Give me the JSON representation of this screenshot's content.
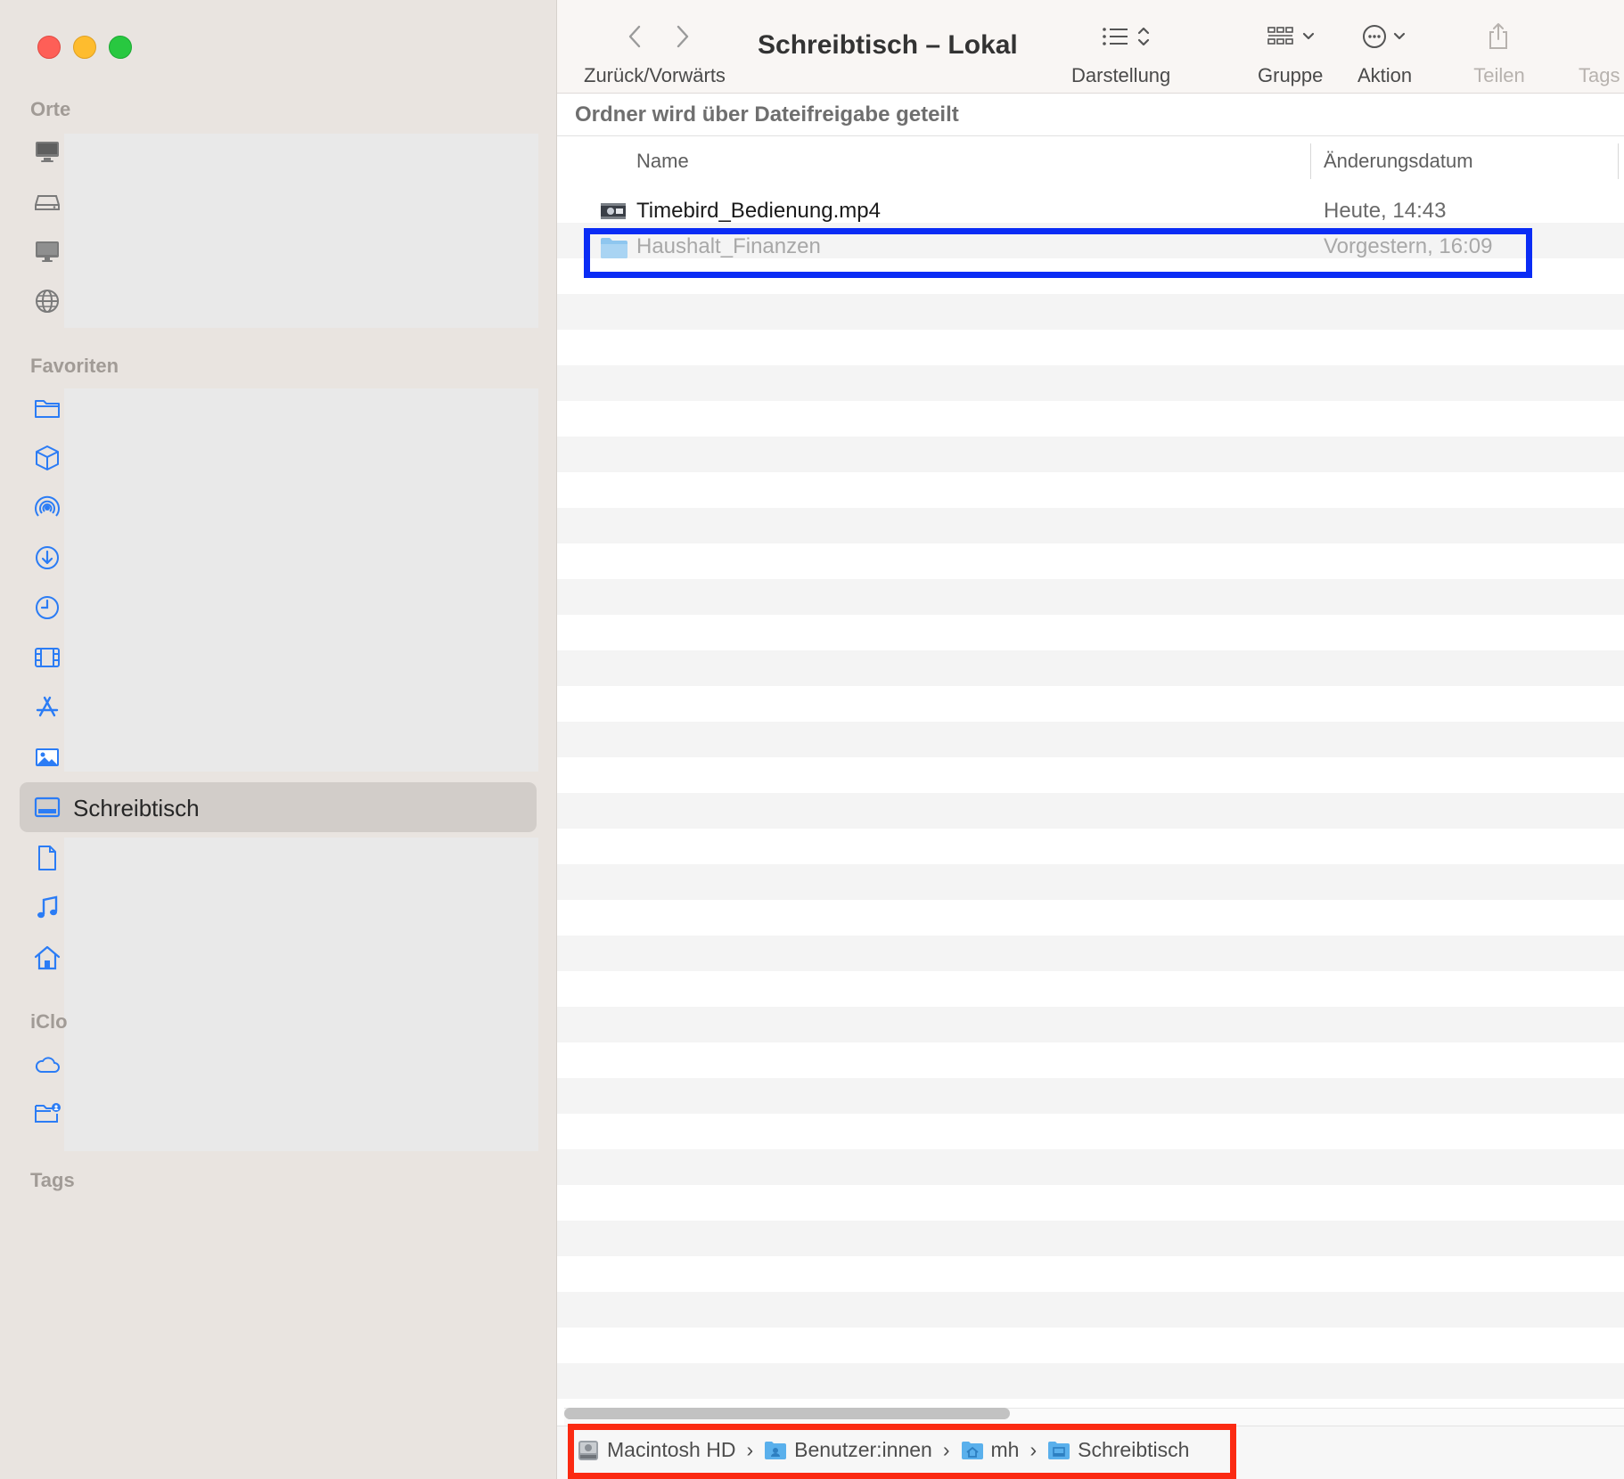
{
  "window": {
    "title": "Schreibtisch – Lokal",
    "controls": [
      "close",
      "minimize",
      "zoom"
    ]
  },
  "sidebar": {
    "sections": {
      "orte": "Orte",
      "favoriten": "Favoriten",
      "icloud": "iClo",
      "tags": "Tags"
    },
    "orte_icons": [
      "computer-icon",
      "disk-icon",
      "display-icon",
      "network-icon"
    ],
    "favoriten_icons": [
      "folder-icon",
      "box-icon",
      "airdrop-icon",
      "download-icon",
      "recents-icon",
      "movies-icon",
      "applications-icon",
      "pictures-icon"
    ],
    "selected": {
      "label": "Schreibtisch",
      "icon": "desktop-icon"
    },
    "favoriten_icons_after": [
      "document-icon",
      "music-icon",
      "home-icon"
    ],
    "icloud_icons": [
      "cloud-icon",
      "shared-folder-icon"
    ]
  },
  "toolbar": {
    "nav_label": "Zurück/Vorwärts",
    "view_label": "Darstellung",
    "group_label": "Gruppe",
    "action_label": "Aktion",
    "share_label": "Teilen",
    "tags_label": "Tags"
  },
  "share_notice": "Ordner wird über Dateifreigabe geteilt",
  "columns": {
    "name": "Name",
    "date": "Änderungsdatum"
  },
  "files": [
    {
      "name": "Timebird_Bedienung.mp4",
      "date": "Heute, 14:43",
      "icon": "video-file-icon"
    },
    {
      "name": "Haushalt_Finanzen",
      "date": "Vorgestern, 16:09",
      "icon": "folder-icon"
    }
  ],
  "pathbar": [
    {
      "label": "Macintosh HD",
      "icon": "hard-drive-icon"
    },
    {
      "label": "Benutzer:innen",
      "icon": "users-folder-icon"
    },
    {
      "label": "mh",
      "icon": "home-folder-icon"
    },
    {
      "label": "Schreibtisch",
      "icon": "desktop-folder-icon"
    }
  ],
  "colors": {
    "accent": "#2b7cf5",
    "highlight_blue": "#0a2cf5",
    "highlight_red": "#fb2a12",
    "sidebar_bg": "#e9e4e0"
  }
}
